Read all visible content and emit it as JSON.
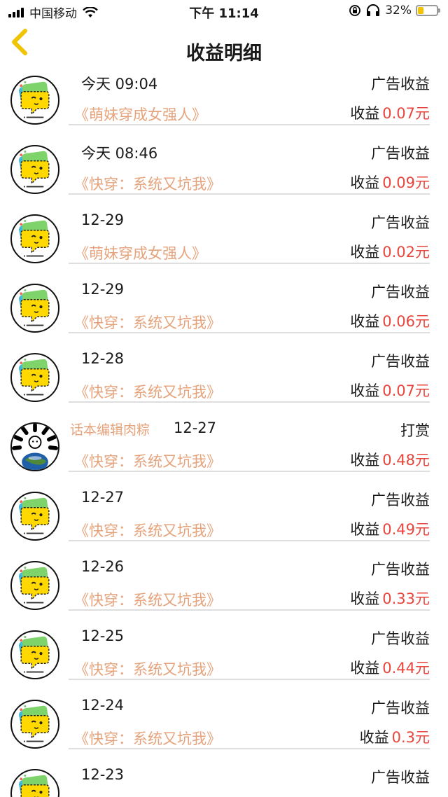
{
  "status_bar": {
    "carrier": "中国移动",
    "time": "下午 11:14",
    "battery": "32%",
    "battery_level": 0.32,
    "icons": [
      "signal-icon",
      "wifi-icon",
      "rotation-lock-icon",
      "headphones-icon",
      "battery-icon"
    ]
  },
  "nav": {
    "title": "收益明细",
    "back_icon": "chevron-left-icon",
    "accent": "#f0c400"
  },
  "colors": {
    "book_title": "#e5a37c",
    "amount": "#e8453c",
    "divider": "#dedede"
  },
  "earn_label": "收益",
  "rows": [
    {
      "date": "今天 09:04",
      "type": "广告收益",
      "book": "《萌妹穿成女强人》",
      "amount": "0.07元",
      "avatar": "app-logo-icon"
    },
    {
      "date": "今天 08:46",
      "type": "广告收益",
      "book": "《快穿：系统又坑我》",
      "amount": "0.09元",
      "avatar": "app-logo-icon"
    },
    {
      "date": "12-29",
      "type": "广告收益",
      "book": "《萌妹穿成女强人》",
      "amount": "0.02元",
      "avatar": "app-logo-icon"
    },
    {
      "date": "12-29",
      "type": "广告收益",
      "book": "《快穿：系统又坑我》",
      "amount": "0.06元",
      "avatar": "app-logo-icon"
    },
    {
      "date": "12-28",
      "type": "广告收益",
      "book": "《快穿：系统又坑我》",
      "amount": "0.07元",
      "avatar": "app-logo-icon"
    },
    {
      "sender": "话本编辑肉粽",
      "date": "12-27",
      "type": "打赏",
      "book": "《快穿：系统又坑我》",
      "amount": "0.48元",
      "avatar": "earth-avatar-icon"
    },
    {
      "date": "12-27",
      "type": "广告收益",
      "book": "《快穿：系统又坑我》",
      "amount": "0.49元",
      "avatar": "app-logo-icon"
    },
    {
      "date": "12-26",
      "type": "广告收益",
      "book": "《快穿：系统又坑我》",
      "amount": "0.33元",
      "avatar": "app-logo-icon"
    },
    {
      "date": "12-25",
      "type": "广告收益",
      "book": "《快穿：系统又坑我》",
      "amount": "0.44元",
      "avatar": "app-logo-icon"
    },
    {
      "date": "12-24",
      "type": "广告收益",
      "book": "《快穿：系统又坑我》",
      "amount": "0.3元",
      "avatar": "app-logo-icon"
    },
    {
      "date": "12-23",
      "type": "广告收益",
      "avatar": "app-logo-icon"
    }
  ]
}
